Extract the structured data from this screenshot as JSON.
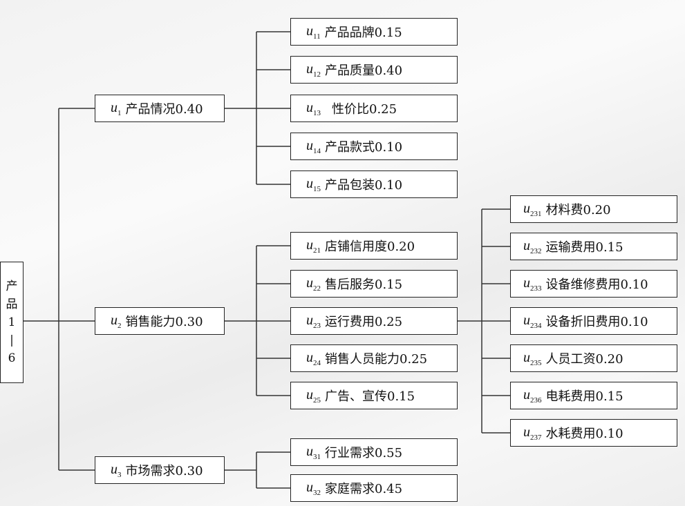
{
  "root": {
    "chars": [
      "产",
      "品",
      "1",
      "|",
      "6"
    ]
  },
  "level1": [
    {
      "sym": "u",
      "sub": "1",
      "label": "产品情况0.40"
    },
    {
      "sym": "u",
      "sub": "2",
      "label": "销售能力0.30"
    },
    {
      "sym": "u",
      "sub": "3",
      "label": "市场需求0.30"
    }
  ],
  "group1": [
    {
      "sym": "u",
      "sub": "11",
      "label": "产品品牌0.15"
    },
    {
      "sym": "u",
      "sub": "12",
      "label": "产品质量0.40"
    },
    {
      "sym": "u",
      "sub": "13",
      "label": "性价比0.25"
    },
    {
      "sym": "u",
      "sub": "14",
      "label": "产品款式0.10"
    },
    {
      "sym": "u",
      "sub": "15",
      "label": "产品包装0.10"
    }
  ],
  "group2": [
    {
      "sym": "u",
      "sub": "21",
      "label": "店铺信用度0.20"
    },
    {
      "sym": "u",
      "sub": "22",
      "label": "售后服务0.15"
    },
    {
      "sym": "u",
      "sub": "23",
      "label": "运行费用0.25"
    },
    {
      "sym": "u",
      "sub": "24",
      "label": "销售人员能力0.25"
    },
    {
      "sym": "u",
      "sub": "25",
      "label": "广告、宣传0.15"
    }
  ],
  "group3": [
    {
      "sym": "u",
      "sub": "31",
      "label": "行业需求0.55"
    },
    {
      "sym": "u",
      "sub": "32",
      "label": "家庭需求0.45"
    }
  ],
  "group23": [
    {
      "sym": "u",
      "sub": "231",
      "label": "材料费0.20"
    },
    {
      "sym": "u",
      "sub": "232",
      "label": "运输费用0.15"
    },
    {
      "sym": "u",
      "sub": "233",
      "label": "设备维修费用0.10"
    },
    {
      "sym": "u",
      "sub": "234",
      "label": "设备折旧费用0.10"
    },
    {
      "sym": "u",
      "sub": "235",
      "label": "人员工资0.20"
    },
    {
      "sym": "u",
      "sub": "236",
      "label": "电耗费用0.15"
    },
    {
      "sym": "u",
      "sub": "237",
      "label": "水耗费用0.10"
    }
  ]
}
